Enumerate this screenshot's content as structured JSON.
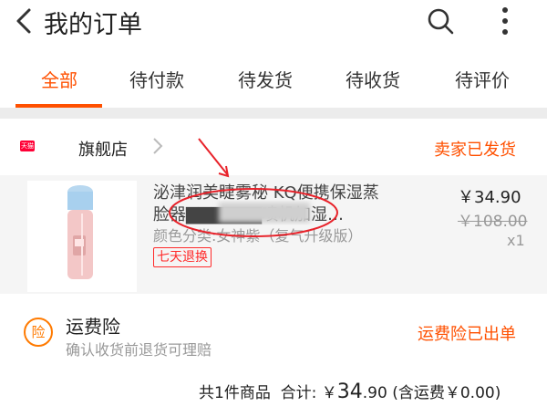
{
  "header": {
    "title": "我的订单"
  },
  "tabs": [
    {
      "label": "全部",
      "active": true
    },
    {
      "label": "待付款"
    },
    {
      "label": "待发货"
    },
    {
      "label": "待收货"
    },
    {
      "label": "待评价"
    }
  ],
  "order": {
    "shop_badge": "天猫",
    "shop_name": "旗舰店",
    "status": "卖家已发货",
    "product": {
      "title_line1": "泌津润美睫雾秘 KQ便携保湿蒸",
      "title_line2": "脸器▇▇▇▇▇▇喷机加湿…",
      "sku": "颜色分类:女神紫（复气升级版）",
      "return_badge": "七天退换",
      "price": "￥34.90",
      "original_price": "￥108.00",
      "quantity": "x1"
    },
    "insurance": {
      "icon": "险",
      "title": "运费险",
      "subtitle": "确认收货前退货可理赔",
      "status": "运费险已出单"
    },
    "summary": {
      "items": "共1件商品",
      "total_label": "合计:",
      "currency": "￥",
      "total_int": "34",
      "total_dec": ".90",
      "shipping": "(含运费￥0.00)"
    }
  },
  "colors": {
    "accent": "#ff5000",
    "badge_red": "#ff2a2a",
    "annotation": "#e8222a"
  }
}
